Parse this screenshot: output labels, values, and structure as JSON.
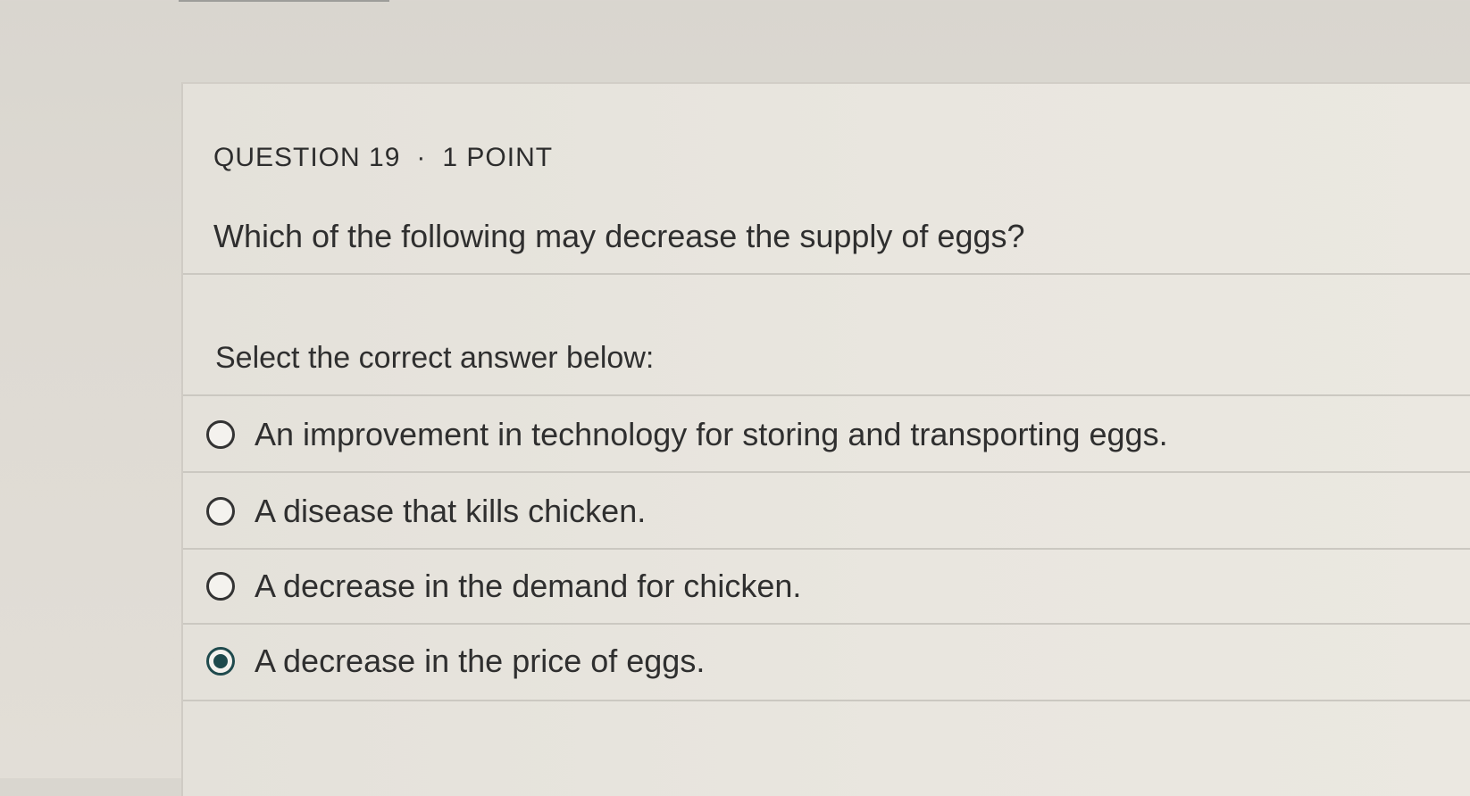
{
  "question": {
    "number_label": "QUESTION 19",
    "separator": "·",
    "points_label": "1 POINT",
    "text": "Which of the following may decrease the supply of eggs?",
    "prompt": "Select the correct answer below:"
  },
  "options": [
    {
      "label": "An improvement in technology for storing and transporting eggs.",
      "selected": false
    },
    {
      "label": "A disease that kills chicken.",
      "selected": false
    },
    {
      "label": "A decrease in the demand for chicken.",
      "selected": false
    },
    {
      "label": "A decrease in the price of eggs.",
      "selected": true
    }
  ],
  "colors": {
    "selected_radio": "#1f4a4d"
  }
}
